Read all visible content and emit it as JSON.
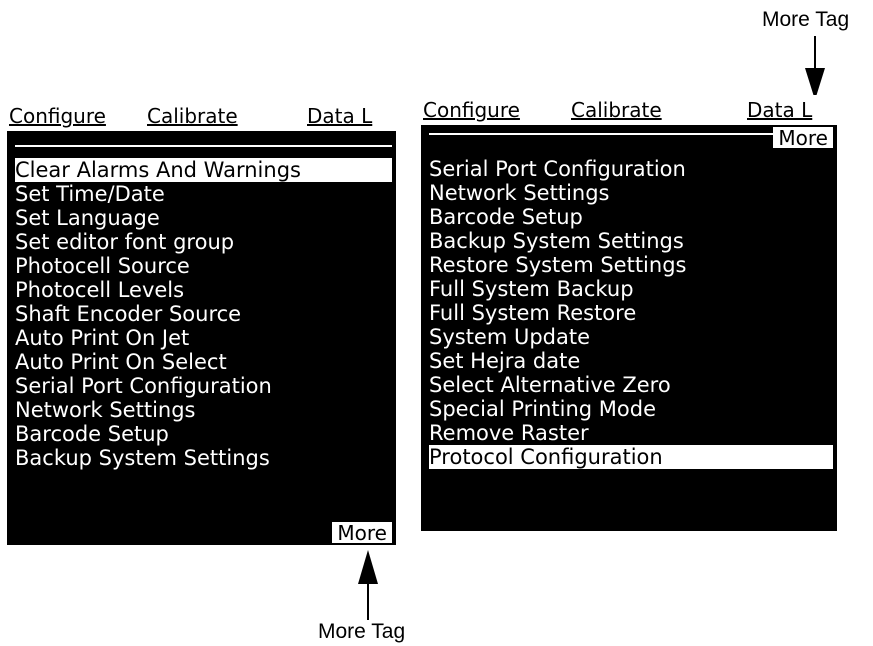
{
  "callouts": {
    "top": "More Tag",
    "bottom": "More Tag"
  },
  "left_screen": {
    "menu_tabs": [
      "Configure",
      "Calibrate",
      "Data L"
    ],
    "items": [
      "Clear Alarms And Warnings",
      "Set Time/Date",
      "Set Language",
      "Set editor font group",
      "Photocell Source",
      "Photocell Levels",
      "Shaft Encoder Source",
      "Auto Print On Jet",
      "Auto Print On Select",
      "Serial Port Configuration",
      "Network Settings",
      "Barcode Setup",
      "Backup System Settings"
    ],
    "selected_index": 0,
    "more_label": "More"
  },
  "right_screen": {
    "menu_tabs": [
      "Configure",
      "Calibrate",
      "Data L"
    ],
    "items": [
      "Serial Port Configuration",
      "Network Settings",
      "Barcode Setup",
      "Backup System Settings",
      "Restore System Settings",
      "Full System Backup",
      "Full System Restore",
      "System Update",
      "Set Hejra date",
      "Select Alternative Zero",
      "Special Printing Mode",
      "Remove Raster",
      "Protocol Configuration"
    ],
    "selected_index": 12,
    "more_label": "More"
  },
  "colors": {
    "screen_bg": "#000000",
    "screen_fg": "#ffffff",
    "page_bg": "#ffffff"
  }
}
